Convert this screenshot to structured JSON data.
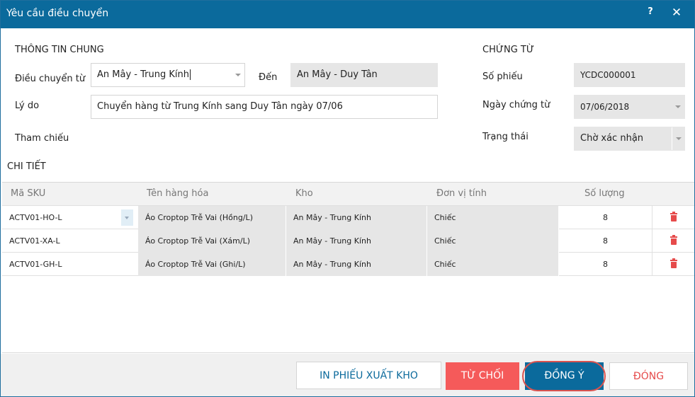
{
  "window": {
    "title": "Yêu cầu điều chuyển",
    "help_label": "?",
    "close_label": "✕"
  },
  "general": {
    "section_title": "THÔNG TIN CHUNG",
    "from_label": "Điều chuyển từ",
    "from_value": "An Mây - Trung Kính",
    "to_label": "Đến",
    "to_value": "An Mây - Duy Tân",
    "reason_label": "Lý do",
    "reason_value": "Chuyển hàng từ Trung Kính sang Duy Tân ngày 07/06",
    "reference_label": "Tham chiếu"
  },
  "voucher": {
    "section_title": "CHỨNG TỪ",
    "number_label": "Số phiếu",
    "number_value": "YCDC000001",
    "date_label": "Ngày chứng từ",
    "date_value": "07/06/2018",
    "status_label": "Trạng thái",
    "status_value": "Chờ xác nhận"
  },
  "details": {
    "section_title": "CHI TIẾT",
    "columns": [
      "Mã SKU",
      "Tên hàng hóa",
      "Kho",
      "Đơn vị tính",
      "Số lượng"
    ],
    "rows": [
      {
        "sku": "ACTV01-HO-L",
        "name": "Áo Croptop Trễ Vai (Hồng/L)",
        "warehouse": "An Mây - Trung Kính",
        "unit": "Chiếc",
        "qty": "8"
      },
      {
        "sku": "ACTV01-XA-L",
        "name": "Áo Croptop Trễ Vai (Xám/L)",
        "warehouse": "An Mây - Trung Kính",
        "unit": "Chiếc",
        "qty": "8"
      },
      {
        "sku": "ACTV01-GH-L",
        "name": "Áo Croptop Trễ Vai (Ghi/L)",
        "warehouse": "An Mây - Trung Kính",
        "unit": "Chiếc",
        "qty": "8"
      }
    ]
  },
  "footer": {
    "print_label": "IN PHIẾU XUẤT KHO",
    "reject_label": "TỪ CHỐI",
    "accept_label": "ĐỒNG Ý",
    "close_label": "ĐÓNG"
  },
  "colors": {
    "titlebar": "#0b6a9c",
    "reject": "#f55a5a",
    "delete_icon": "#e64b4b",
    "highlight_ring": "#d9534f"
  }
}
